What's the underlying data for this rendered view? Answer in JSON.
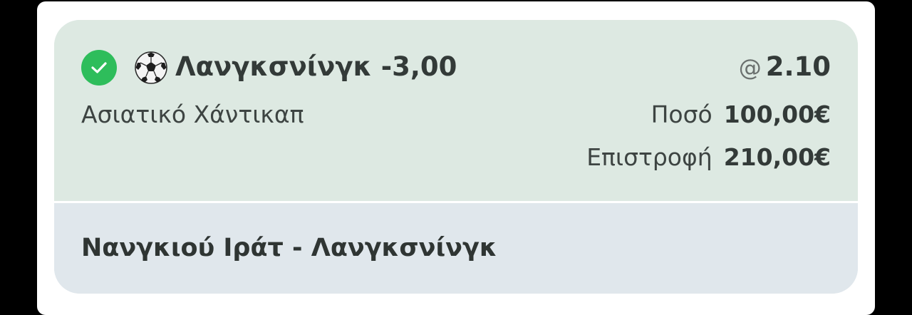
{
  "bet": {
    "status": "won",
    "sport_icon": "soccer-ball-icon",
    "selection": "Λανγκσνίνγκ -3,00",
    "market": "Ασιατικό Χάντικαπ",
    "odds_prefix": "@",
    "odds": "2.10",
    "stake_label": "Ποσό",
    "stake_value": "100,00€",
    "return_label": "Επιστροφή",
    "return_value": "210,00€",
    "event": "Νανγκιού Ιράτ - Λανγκσνίνγκ"
  },
  "colors": {
    "success": "#2ebd5b",
    "card_top_bg": "#dde9e2",
    "card_bottom_bg": "#e0e7ec"
  }
}
